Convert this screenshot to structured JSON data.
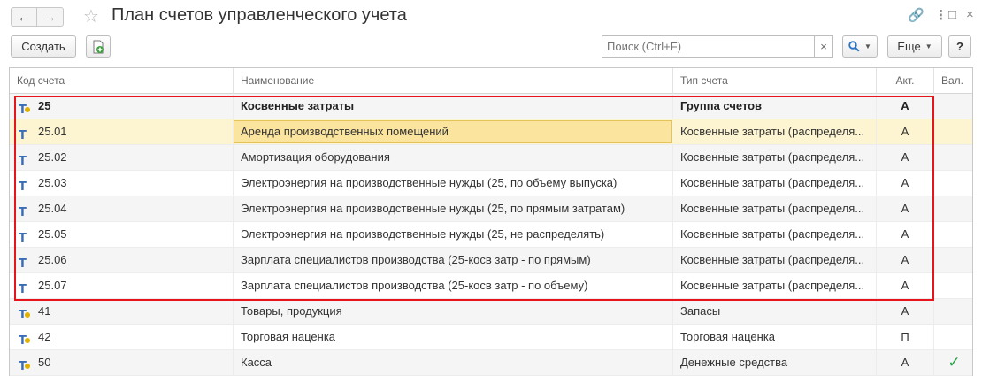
{
  "window": {
    "title": "План счетов управленческого учета",
    "back_icon": "arrow-left-icon",
    "forward_icon": "arrow-right-icon",
    "favorite_icon": "star-icon",
    "link_icon": "link-icon",
    "menu_icon": "vertical-dots-icon",
    "maximize_icon": "maximize-icon",
    "close_icon": "close-icon"
  },
  "toolbar": {
    "create_label": "Создать",
    "search_placeholder": "Поиск (Ctrl+F)",
    "clear_label": "×",
    "more_label": "Еще",
    "help_label": "?"
  },
  "table": {
    "columns": [
      "Код счета",
      "Наименование",
      "Тип счета",
      "Акт.",
      "Вал."
    ],
    "rows": [
      {
        "code": "25",
        "name": "Косвенные затраты",
        "type": "Группа счетов",
        "act": "А",
        "val": "",
        "icon": "group-account-icon",
        "bold": true,
        "selected": false
      },
      {
        "code": "25.01",
        "name": "Аренда производственных помещений",
        "type": "Косвенные затраты (распределя...",
        "act": "А",
        "val": "",
        "icon": "account-icon",
        "bold": false,
        "selected": true
      },
      {
        "code": "25.02",
        "name": "Амортизация оборудования",
        "type": "Косвенные затраты (распределя...",
        "act": "А",
        "val": "",
        "icon": "account-icon",
        "bold": false,
        "selected": false
      },
      {
        "code": "25.03",
        "name": "Электроэнергия на производственные нужды (25, по объему выпуска)",
        "type": "Косвенные затраты (распределя...",
        "act": "А",
        "val": "",
        "icon": "account-icon",
        "bold": false,
        "selected": false
      },
      {
        "code": "25.04",
        "name": "Электроэнергия на производственные нужды (25, по прямым затратам)",
        "type": "Косвенные затраты (распределя...",
        "act": "А",
        "val": "",
        "icon": "account-icon",
        "bold": false,
        "selected": false
      },
      {
        "code": "25.05",
        "name": "Электроэнергия на производственные нужды (25, не распределять)",
        "type": "Косвенные затраты (распределя...",
        "act": "А",
        "val": "",
        "icon": "account-icon",
        "bold": false,
        "selected": false
      },
      {
        "code": "25.06",
        "name": "Зарплата специалистов производства (25-косв затр - по прямым)",
        "type": "Косвенные затраты (распределя...",
        "act": "А",
        "val": "",
        "icon": "account-icon",
        "bold": false,
        "selected": false
      },
      {
        "code": "25.07",
        "name": "Зарплата специалистов производства (25-косв затр - по объему)",
        "type": "Косвенные затраты (распределя...",
        "act": "А",
        "val": "",
        "icon": "account-icon",
        "bold": false,
        "selected": false
      },
      {
        "code": "41",
        "name": "Товары, продукция",
        "type": "Запасы",
        "act": "А",
        "val": "",
        "icon": "group-account-icon",
        "bold": false,
        "selected": false
      },
      {
        "code": "42",
        "name": "Торговая наценка",
        "type": "Торговая наценка",
        "act": "П",
        "val": "",
        "icon": "group-account-icon",
        "bold": false,
        "selected": false
      },
      {
        "code": "50",
        "name": "Касса",
        "type": "Денежные средства",
        "act": "А",
        "val": "✓",
        "icon": "group-account-icon",
        "bold": false,
        "selected": false
      }
    ]
  },
  "colors": {
    "highlight_frame": "#e8141c",
    "selected_row": "#fdf4d1",
    "focused_cell": "#fbe49e",
    "currency_check": "#21a040"
  }
}
